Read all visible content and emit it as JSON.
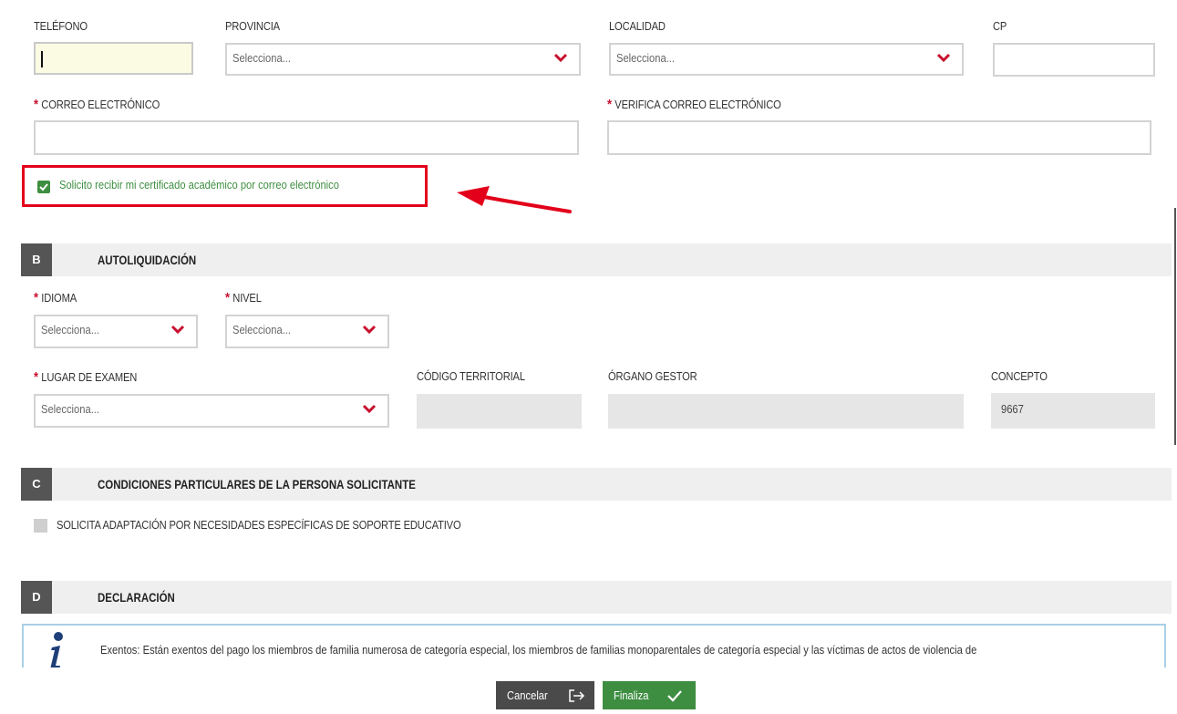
{
  "contact": {
    "telefono_label": "TELÉFONO",
    "provincia_label": "PROVINCIA",
    "provincia_placeholder": "Selecciona...",
    "localidad_label": "LOCALIDAD",
    "localidad_placeholder": "Selecciona...",
    "cp_label": "CP",
    "correo_label": "CORREO ELECTRÓNICO",
    "verifica_label": "VERIFICA CORREO ELECTRÓNICO",
    "required_mark": "*"
  },
  "certificate_checkbox": {
    "label": "Solicito recibir mi certificado académico por correo electrónico",
    "checked": true
  },
  "section_b": {
    "letter": "B",
    "title": "AUTOLIQUIDACIÓN",
    "idioma_label": "IDIOMA",
    "idioma_placeholder": "Selecciona...",
    "nivel_label": "NIVEL",
    "nivel_placeholder": "Selecciona...",
    "lugar_label": "LUGAR DE EXAMEN",
    "lugar_placeholder": "Selecciona...",
    "codigo_label": "CÓDIGO TERRITORIAL",
    "organo_label": "ÓRGANO GESTOR",
    "concepto_label": "CONCEPTO",
    "concepto_value": "9667"
  },
  "section_c": {
    "letter": "C",
    "title": "CONDICIONES PARTICULARES DE LA PERSONA SOLICITANTE",
    "adaptacion_label": "SOLICITA ADAPTACIÓN POR NECESIDADES ESPECÍFICAS DE SOPORTE EDUCATIVO"
  },
  "section_d": {
    "letter": "D",
    "title": "DECLARACIÓN",
    "info_text": "Exentos: Están exentos del pago los miembros de familia numerosa de categoría especial, los miembros de familias monoparentales de categoría especial y las víctimas de actos de violencia de"
  },
  "footer": {
    "cancel_label": "Cancelar",
    "finish_label": "Finaliza"
  },
  "colors": {
    "accent_green": "#3e8e41",
    "required_red": "#c8102e",
    "highlight_red": "#e3001b"
  }
}
